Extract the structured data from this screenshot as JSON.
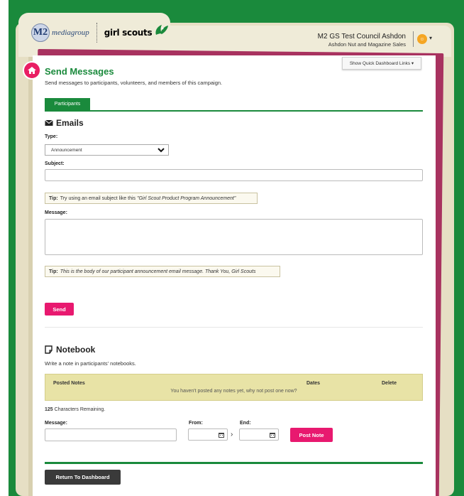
{
  "header": {
    "m2": "M2",
    "mediagroup": "mediagroup",
    "gs_logo_text": "girl scouts",
    "account_name": "M2 GS Test Council Ashdon",
    "account_sub": "Ashdon Nut and Magazine Sales",
    "user_badge": "☺"
  },
  "quick_links_label": "Show Quick Dashboard Links ▾",
  "page": {
    "title": "Send Messages",
    "description": "Send messages to participants, volunteers, and members of this campaign."
  },
  "tabs": [
    {
      "label": "Participants",
      "active": true
    }
  ],
  "emails": {
    "title": "Emails",
    "type_label": "Type:",
    "type_value": "Announcement",
    "subject_label": "Subject:",
    "subject_value": "",
    "tip1_prefix": "Tip:",
    "tip1_plain": "Try using an email subject like this",
    "tip1_example": "\"Girl Scout Product Program Announcement\"",
    "message_label": "Message:",
    "message_value": "",
    "tip2_prefix": "Tip:",
    "tip2_text": "This is the body of our participant announcement email message. Thank You, Girl Scouts",
    "send_label": "Send"
  },
  "notebook": {
    "title": "Notebook",
    "description": "Write a note in participants' notebooks.",
    "columns": [
      "Posted Notes",
      "Dates",
      "Delete"
    ],
    "empty_text": "You haven't posted any notes yet, why not post one now?",
    "remaining_count": "125",
    "remaining_text": "Characters Remaining.",
    "message_label": "Message:",
    "from_label": "From:",
    "end_label": "End:",
    "post_label": "Post Note"
  },
  "return_label": "Return To Dashboard",
  "colors": {
    "brand_green": "#1a8a3c",
    "accent_pink": "#e8196f",
    "frame_beige": "#e6dfc4"
  }
}
